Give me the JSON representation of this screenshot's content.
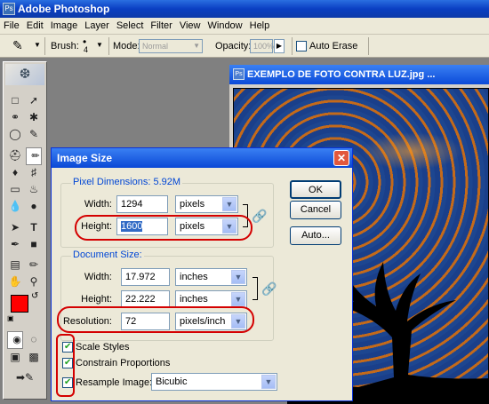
{
  "app": {
    "title": "Adobe Photoshop"
  },
  "menu": [
    "File",
    "Edit",
    "Image",
    "Layer",
    "Select",
    "Filter",
    "View",
    "Window",
    "Help"
  ],
  "options": {
    "brush_label": "Brush:",
    "brush_size": "4",
    "mode_label": "Mode:",
    "mode_value": "Normal",
    "opacity_label": "Opacity:",
    "opacity_value": "100%",
    "auto_erase_label": "Auto Erase"
  },
  "document": {
    "title": "EXEMPLO DE FOTO CONTRA LUZ.jpg ..."
  },
  "dialog": {
    "title": "Image Size",
    "close": "✕",
    "pixel_dimensions": {
      "legend": "Pixel Dimensions:",
      "size": "5.92M",
      "width_label": "Width:",
      "width_value": "1294",
      "width_unit": "pixels",
      "height_label": "Height:",
      "height_value": "1600",
      "height_unit": "pixels"
    },
    "document_size": {
      "legend": "Document Size:",
      "width_label": "Width:",
      "width_value": "17.972",
      "width_unit": "inches",
      "height_label": "Height:",
      "height_value": "22.222",
      "height_unit": "inches",
      "resolution_label": "Resolution:",
      "resolution_value": "72",
      "resolution_unit": "pixels/inch"
    },
    "checkboxes": {
      "scale_styles": "Scale Styles",
      "constrain_proportions": "Constrain Proportions",
      "resample_image": "Resample Image:"
    },
    "resample_method": "Bicubic",
    "buttons": {
      "ok": "OK",
      "cancel": "Cancel",
      "auto": "Auto..."
    }
  },
  "colors": {
    "foreground": "#ff0000",
    "background": "#ffffff",
    "annotation": "#d40000"
  }
}
